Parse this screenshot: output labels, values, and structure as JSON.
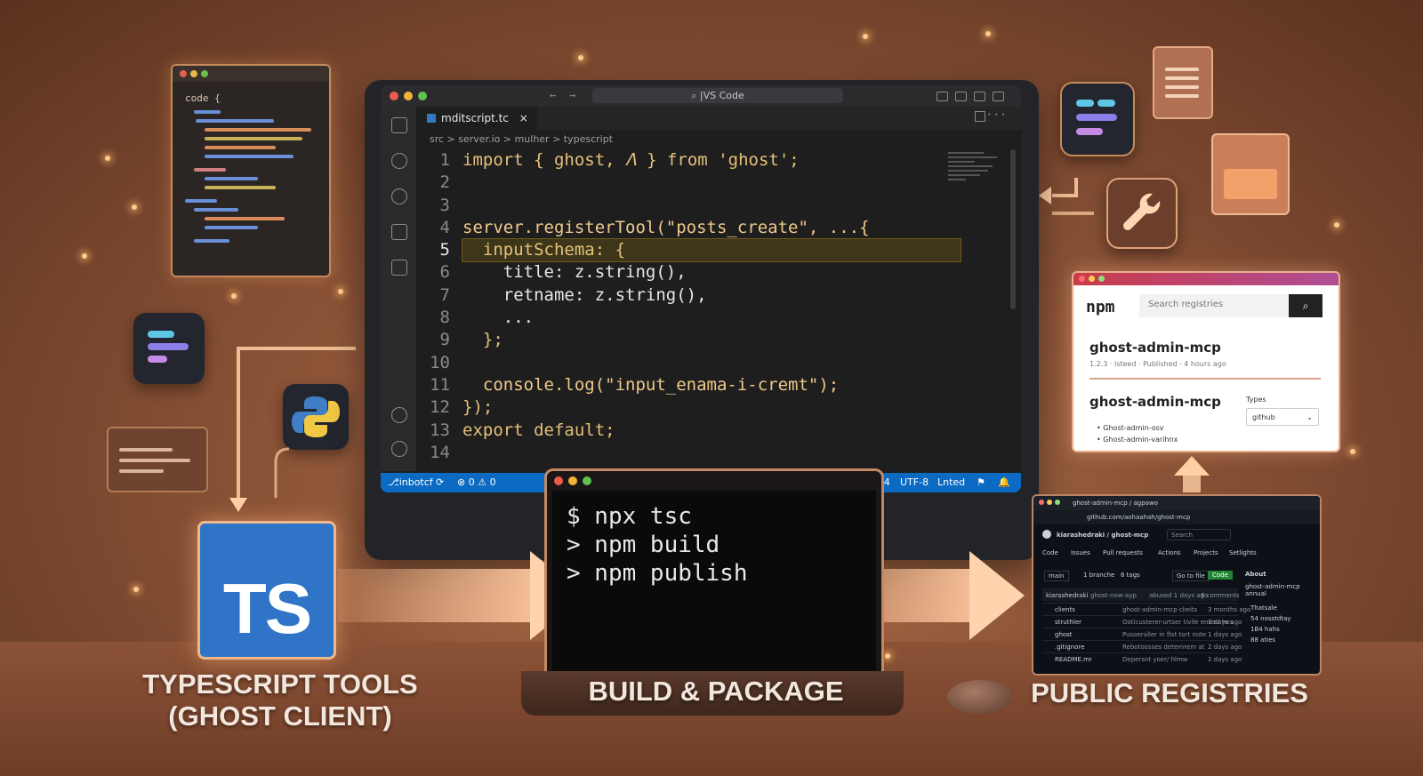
{
  "vscode": {
    "search": "|VS Code",
    "tab": "mditscript.tc",
    "tab_close": "×",
    "breadcrumb": "src > server.io > mulher > typescript",
    "line_numbers": [
      "1",
      "2",
      "3",
      "4",
      "5",
      "6",
      "7",
      "8",
      "9",
      "10",
      "11",
      "12",
      "13",
      "14"
    ],
    "code_lines": [
      "import { ghost, 𝛬 } from 'ghost';",
      "",
      "",
      "server.registerTool(\"posts_create\", ...{",
      "  inputSchema: {",
      "    title: z.string(),",
      "    retname: z.string(),",
      "    ...",
      "  };",
      "",
      "  console.log(\"input_enama-i-cremt\");",
      "});",
      "export default;",
      ""
    ],
    "status": {
      "branch": "inbotcf",
      "sync": "⟳",
      "problems": "⊗ 0 ⚠ 0",
      "spaces": "osee:4",
      "encoding": "UTF-8",
      "linted": "Lnted"
    }
  },
  "codewin": {
    "title": "code {"
  },
  "terminal": {
    "lines": [
      "$ npx tsc",
      "> npm build",
      "> npm publish"
    ]
  },
  "captions": {
    "left_line1": "TYPESCRIPT TOOLS",
    "left_line2": "(GHOST CLIENT)",
    "middle": "BUILD & PACKAGE",
    "right": "PUBLIC REGISTRIES"
  },
  "ts_logo": "TS",
  "npm": {
    "logo": "npm",
    "search_placeholder": "Search registries",
    "package_title": "ghost-admin-mcp",
    "package_meta": "1.2.3 · lsteed · Published · 4 hours ago",
    "package_title2": "ghost-admin-mcp",
    "bullets": [
      "Ghost-admin-osv",
      "Ghost-admin-varihnx"
    ],
    "types_label": "Types",
    "types_value": "github"
  },
  "github": {
    "tab": "ghost-admin-mcp / agpawo",
    "url": "github.com/aohaahah/ghost-mcp",
    "repo": "kiarashedraki / ghost-mcp",
    "search": "Search",
    "nav": [
      "Code",
      "Issues",
      "Pull requests",
      "Actions",
      "Projects",
      "Setlights"
    ],
    "branch": "main",
    "branches": "1 branche",
    "tags": "6 tags",
    "goto_file": "Go to file",
    "code_btn": "Code",
    "about": "About",
    "about_desc": "ghost-admin-mcp annual",
    "commit_user": "kiarashedraki",
    "commit_msg": "ghost-now-ayp",
    "commit_time": "abused 1 days ago",
    "commits": "8 comments",
    "files": [
      {
        "name": "clients",
        "msg": "ghost-admin-mcp ckeits",
        "time": "3 months ago"
      },
      {
        "name": "struthler",
        "msg": "Ooticusterer-urtser tivile ended hes",
        "time": "1 days ago"
      },
      {
        "name": "ghost",
        "msg": "Pusoeraller in ftst tort note",
        "time": "1 days ago"
      },
      {
        "name": ".gitignore",
        "msg": "Rebotoosses deternrem at",
        "time": "2 days ago"
      },
      {
        "name": "README.mr",
        "msg": "Depersnt yoer/ hlmw",
        "time": "2 days ago"
      }
    ],
    "about_items": [
      "Thatsale",
      "54 nosstdtay",
      "1B4 hahs",
      "88 aties"
    ]
  },
  "colors": {
    "accent_glow": "#ffc98a",
    "vscode_status": "#0b6ac2",
    "ts_blue": "#2f74c7",
    "npm_red": "#c83b4a"
  }
}
